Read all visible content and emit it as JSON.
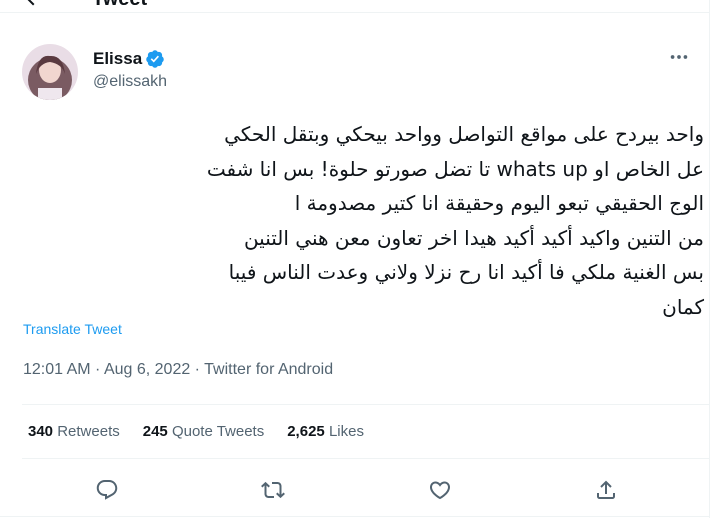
{
  "header": {
    "title": "Tweet",
    "back_icon": "arrow-left-icon"
  },
  "author": {
    "display_name": "Elissa",
    "handle": "@elissakh",
    "verified": true,
    "verified_color": "#1d9bf0"
  },
  "tweet": {
    "text": "واحد بيردح  على مواقع التواصل وواحد بيحكي  وبتقل الحكي\nعل الخاص او whats up تا تضل صورتو حلوة! بس انا شفت\nالوج الحقيقي تبعو اليوم وحقيقة انا كتير  مصدومة ا\nمن التنين واكيد أكيد أكيد هيدا اخر تعاون معن هني التنين\nبس الغنية ملكي فا أكيد انا رح نزلا ولاني وعدت الناس فيبا\nكمان",
    "translate_label": "Translate Tweet",
    "meta": "12:01 AM · Aug 6, 2022 · Twitter for Android"
  },
  "stats": {
    "retweets_count": "340",
    "retweets_label": "Retweets",
    "quotes_count": "245",
    "quotes_label": "Quote Tweets",
    "likes_count": "2,625",
    "likes_label": "Likes"
  },
  "actions": [
    "reply-icon",
    "retweet-icon",
    "like-icon",
    "share-icon"
  ],
  "colors": {
    "accent": "#1d9bf0",
    "text": "#0f1419",
    "secondary": "#536471",
    "border": "#eff3f4"
  }
}
